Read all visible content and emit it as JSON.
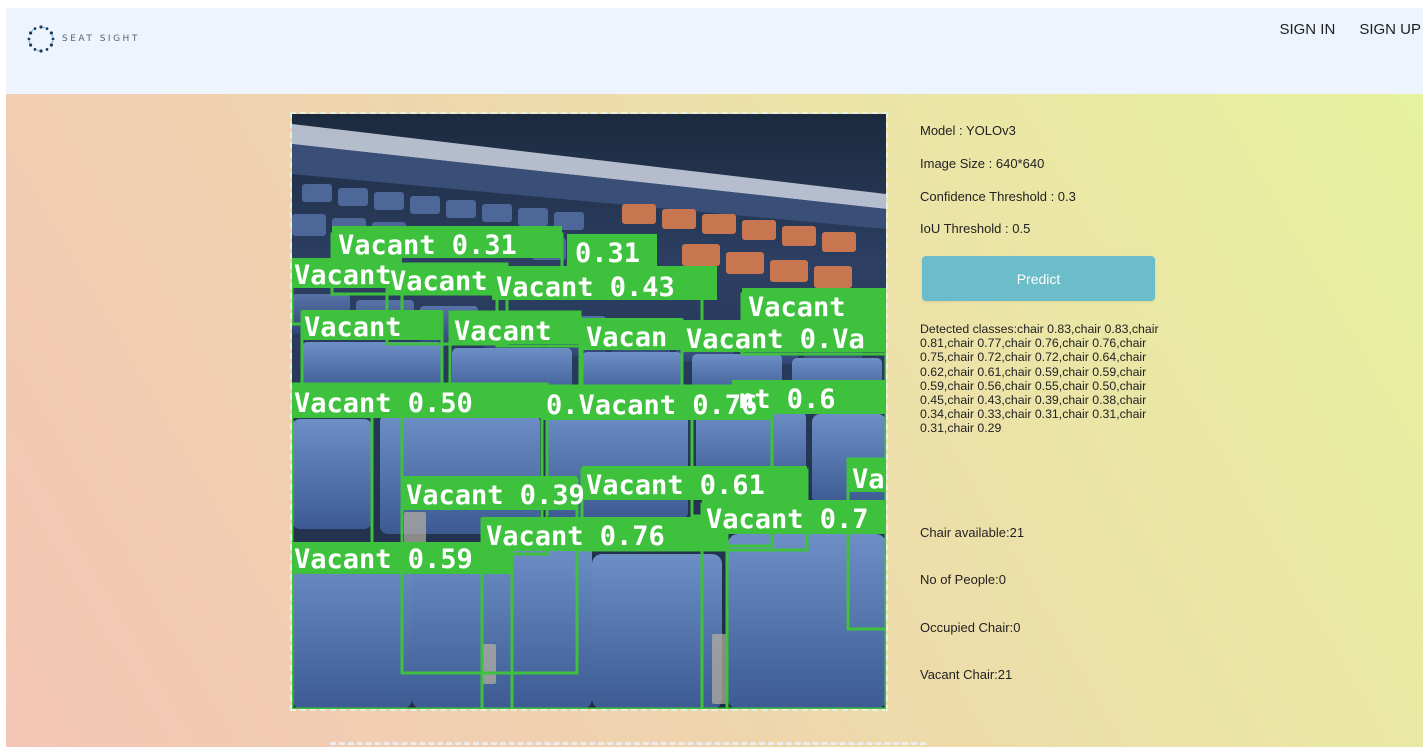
{
  "app": {
    "name": "SEAT SIGHT",
    "logo_icon": "dotted-circle-icon"
  },
  "nav": {
    "sign_in": "SIGN IN",
    "sign_up": "SIGN UP"
  },
  "params": {
    "model": "Model : YOLOv3",
    "image_size": "Image Size : 640*640",
    "confidence": "Confidence Threshold : 0.3",
    "iou": "IoU Threshold : 0.5"
  },
  "predict_label": "Predict",
  "detected_classes": "Detected classes:chair 0.83,chair 0.83,chair 0.81,chair 0.77,chair 0.76,chair 0.76,chair 0.75,chair 0.72,chair 0.72,chair 0.64,chair 0.62,chair 0.61,chair 0.59,chair 0.59,chair 0.59,chair 0.56,chair 0.55,chair 0.50,chair 0.45,chair 0.43,chair 0.39,chair 0.38,chair 0.34,chair 0.33,chair 0.31,chair 0.31,chair 0.31,chair 0.29",
  "stats": {
    "chair_available": "Chair available:21",
    "people": "No of People:0",
    "occupied": "Occupied Chair:0",
    "vacant": "Vacant Chair:21"
  },
  "detection_labels": [
    "Vacant 0.31",
    "0.31",
    "Vacant",
    "Vacant",
    "Vacant 0.43",
    "Vacant",
    "Vacant",
    "Vacant",
    "Vacan",
    "Vacant 0.Va",
    "Vacant 0.50",
    "0.Vacant 0.76",
    "nt 0.6",
    "Vacant 0.39",
    "Vacant 0.61",
    "Va",
    "Vacant 0.76",
    "Vacant 0.7",
    "Vacant 0.59"
  ],
  "colors": {
    "box": "#3ec23e",
    "label_text": "#ffffff",
    "accent": "#6bbdca"
  }
}
